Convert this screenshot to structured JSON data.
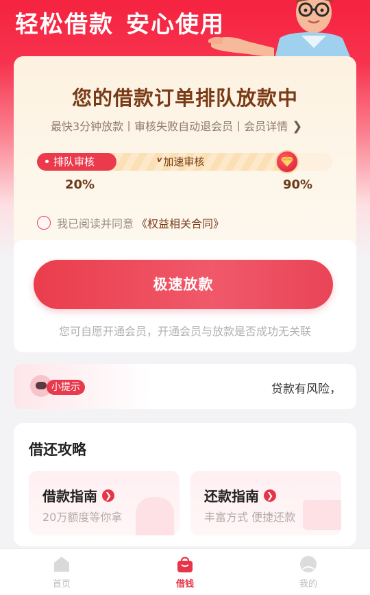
{
  "hero": {
    "slogan_left": "轻松借款",
    "slogan_right": "安心使用"
  },
  "status": {
    "title": "您的借款订单排队放款中",
    "subtitle": "最快3分钟放款丨审核失败自动退会员丨会员详情",
    "progress": {
      "queue_label": "排队审核",
      "speed_label": "加速审核",
      "left_percent": "20%",
      "right_percent": "90%",
      "current_fraction": 0.2,
      "target_fraction": 0.9
    },
    "agreement": {
      "prefix": "我已阅读并同意",
      "contract": "《权益相关合同》"
    }
  },
  "action": {
    "cta_label": "极速放款",
    "disclaimer": "您可自愿开通会员，开通会员与放款是否成功无关联"
  },
  "tip": {
    "tag": "小提示",
    "text": "贷款有风险，"
  },
  "guide": {
    "title": "借还攻略",
    "tiles": [
      {
        "title": "借款指南",
        "subtitle": "20万额度等你拿"
      },
      {
        "title": "还款指南",
        "subtitle": "丰富方式 便捷还款"
      }
    ]
  },
  "tabbar": {
    "items": [
      {
        "label": "首页",
        "icon": "home-icon"
      },
      {
        "label": "借钱",
        "icon": "bag-icon",
        "active": true
      },
      {
        "label": "我的",
        "icon": "profile-icon"
      }
    ]
  },
  "colors": {
    "brand_red": "#e83448",
    "title_brown": "#7a3a16"
  }
}
